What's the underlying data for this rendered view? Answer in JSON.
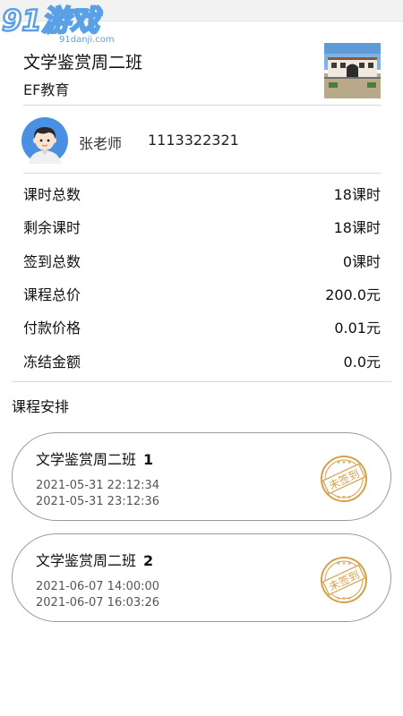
{
  "watermark": {
    "logo_text": "91游戏",
    "site_text": "91danji.com"
  },
  "header": {
    "class_title": "文学鉴赏周二班",
    "org_name": "EF教育"
  },
  "teacher": {
    "name": "张老师",
    "phone": "1113322321"
  },
  "stats": [
    {
      "label": "课时总数",
      "value": "18课时"
    },
    {
      "label": "剩余课时",
      "value": "18课时"
    },
    {
      "label": "签到总数",
      "value": "0课时"
    },
    {
      "label": "课程总价",
      "value": "200.0元"
    },
    {
      "label": "付款价格",
      "value": "0.01元"
    },
    {
      "label": "冻结金额",
      "value": "0.0元"
    }
  ],
  "schedule_section_title": "课程安排",
  "schedule": [
    {
      "title": "文学鉴赏周二班",
      "index": "1",
      "start": "2021-05-31 22:12:34",
      "end": "2021-05-31 23:12:36",
      "stamp_text": "未签到"
    },
    {
      "title": "文学鉴赏周二班",
      "index": "2",
      "start": "2021-06-07 14:00:00",
      "end": "2021-06-07 16:03:26",
      "stamp_text": "未签到"
    }
  ],
  "colors": {
    "stamp": "#d4a04a",
    "avatar_bg": "#4a90e2",
    "card_border": "#9a9a9a",
    "watermark": "#5aa0e6"
  }
}
